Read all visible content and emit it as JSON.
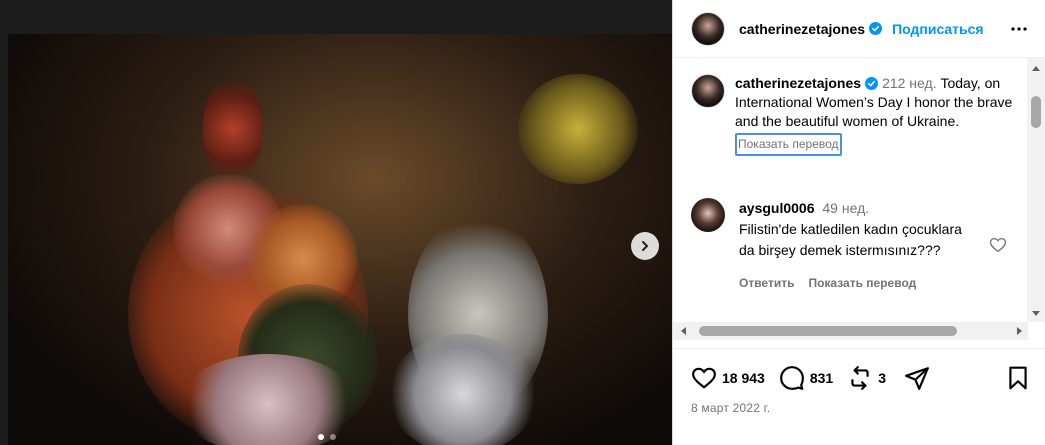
{
  "header": {
    "username": "catherinezetajones",
    "follow_label": "Подписаться"
  },
  "caption": {
    "username": "catherinezetajones",
    "age": "212 нед.",
    "text": "Today, on International Women’s Day I honor the brave and the beautiful women of Ukraine.",
    "translate_label": "Показать перевод"
  },
  "comment": {
    "username": "aysgul0006",
    "age": "49 нед.",
    "text": "Filistin'de katledilen kadın çocuklara da birşey demek istermısınız???",
    "reply_label": "Ответить",
    "translate_label": "Показать перевод"
  },
  "actions": {
    "likes": "18 943",
    "comments": "831",
    "reposts": "3"
  },
  "date": "8 март 2022 г.",
  "colors": {
    "accent": "#0095f6",
    "verified": "#0095f6",
    "muted": "#737373"
  }
}
